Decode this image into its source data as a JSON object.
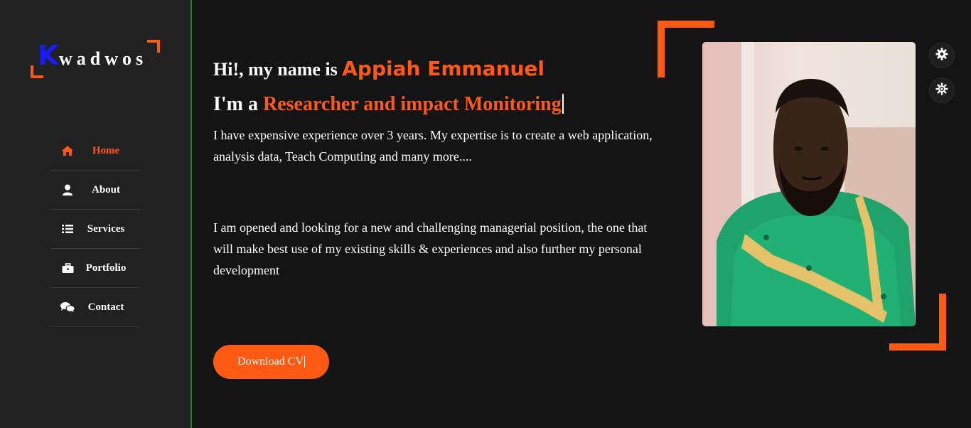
{
  "brand": {
    "logo_initial": "K",
    "logo_rest": "wadwos"
  },
  "nav": {
    "items": [
      {
        "label": "Home",
        "icon": "home-icon",
        "active": true
      },
      {
        "label": "About",
        "icon": "user-icon",
        "active": false
      },
      {
        "label": "Services",
        "icon": "list-icon",
        "active": false
      },
      {
        "label": "Portfolio",
        "icon": "briefcase-icon",
        "active": false
      },
      {
        "label": "Contact",
        "icon": "chat-icon",
        "active": false
      }
    ]
  },
  "hero": {
    "greeting_prefix": "Hi!, my name is ",
    "name": "Appiah Emmanuel",
    "role_prefix": "I'm a ",
    "role_text": "Researcher and impact Monitoring",
    "paragraph1": "I have expensive experience over 3 years. My expertise is to create a web application, analysis data, Teach Computing and many more....",
    "paragraph2": "I am opened and looking for a new and challenging managerial position, the one that will make best use of my existing skills & experiences and also further my personal development",
    "cta_label": "Download CV"
  },
  "colors": {
    "accent": "#ff5a14",
    "background": "#141414",
    "sidebar": "#212121",
    "logo_k": "#1a1aff",
    "divider": "#1f8a1f"
  },
  "settings": {
    "icons": [
      "gear-icon",
      "sun-gear-icon"
    ]
  }
}
